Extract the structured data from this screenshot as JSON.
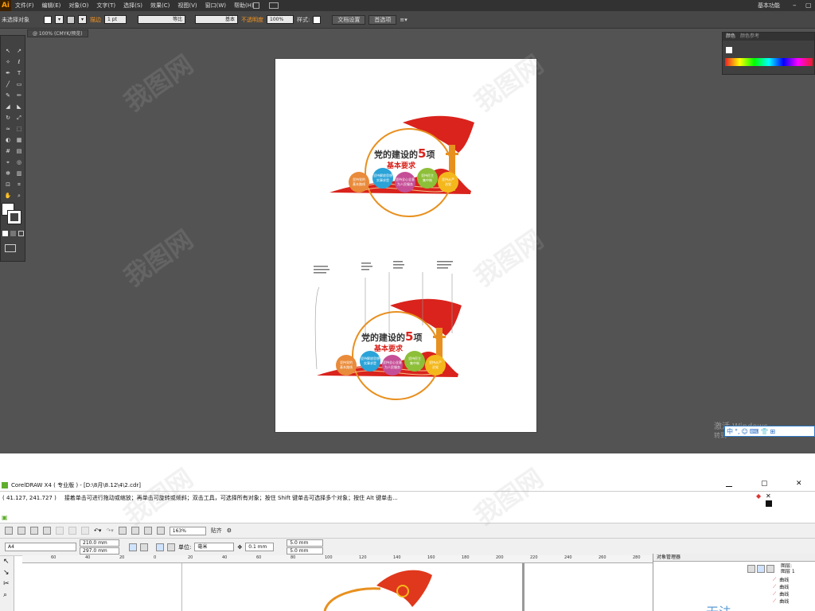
{
  "illustrator": {
    "logo": "Ai",
    "menus": [
      "文件(F)",
      "编辑(E)",
      "对象(O)",
      "文字(T)",
      "选择(S)",
      "效果(C)",
      "视图(V)",
      "窗口(W)",
      "帮助(H)"
    ],
    "workspace": "基本功能",
    "control": {
      "no_selection": "未选择对象",
      "stroke_label": "描边",
      "stroke_weight": "1 pt",
      "stroke_profile": "等比",
      "brush": "基本",
      "opacity_label": "不透明度",
      "opacity_value": "100%",
      "style_label": "样式:",
      "doc_setup": "文档设置",
      "preferences": "首选项"
    },
    "doc_tab": "@ 100% (CMYK/预览)",
    "color_panel": {
      "tab_color": "颜色",
      "tab_guide": "颜色参考"
    },
    "windows_activate": "激活 Windows",
    "windows_activate_sub": "转到",
    "ime": [
      "中",
      "°,",
      "☺",
      "⌨",
      "👕",
      "⊞"
    ]
  },
  "design": {
    "title": "党的建设的",
    "title_num": "5",
    "title_suffix": "项",
    "subtitle": "基本要求",
    "circles": [
      {
        "label1": "坚持党的",
        "label2": "基本路线",
        "color": "#e98b3a"
      },
      {
        "label1": "坚持解放思想",
        "label2": "实事求是",
        "color": "#2aa3d8"
      },
      {
        "label1": "坚持全心全意",
        "label2": "为人民服务",
        "color": "#c54f97"
      },
      {
        "label1": "坚持民主",
        "label2": "集中制",
        "color": "#8dbf38"
      },
      {
        "label1": "坚持从严",
        "label2": "治党",
        "color": "#f4b81c"
      }
    ],
    "brand_colors": {
      "red": "#d9231c",
      "orange": "#e8901f",
      "gold": "#f4b81c"
    }
  },
  "coreldraw": {
    "title": "CorelDRAW X4 ( 专业版 ) - [D:\\8月\\8.12\\4\\2.cdr]",
    "coords": "( 41.127, 241.727 )",
    "status_msg": "接着单击可进行拖动或缩放；再单击可旋转或倾斜；双击工具，可选择所有对象；按住 Shift 键单击可选择多个对象；按住 Alt 键单击...",
    "zoom": "163%",
    "snap_label": "贴齐",
    "page_size": "A4",
    "width": "210.0 mm",
    "height": "297.0 mm",
    "unit_label": "单位:",
    "unit": "毫米",
    "nudge": "0.1 mm",
    "dup_x": "5.0 mm",
    "dup_y": "5.0 mm",
    "ruler_ticks": [
      "60",
      "40",
      "20",
      "0",
      "20",
      "40",
      "60",
      "80",
      "100",
      "120",
      "140",
      "160",
      "180",
      "200",
      "220",
      "240",
      "260",
      "280"
    ],
    "obj_manager_title": "对象管理器",
    "layer_label": "图层:",
    "layer_name": "图层 1",
    "curves": [
      "曲线",
      "曲线",
      "曲线",
      "曲线"
    ],
    "no_preview": "无法"
  }
}
